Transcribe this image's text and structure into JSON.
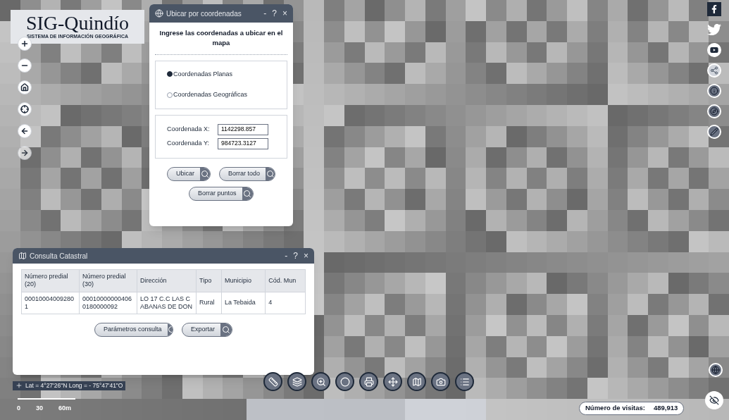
{
  "logo": {
    "title": "SIG-Quindío",
    "subtitle": "SISTEMA DE INFORMACIÓN GEOGRÁFICA"
  },
  "coord_dialog": {
    "title": "Ubicar por coordenadas",
    "window_controls": [
      "-",
      "?",
      "×"
    ],
    "heading": "Ingrese las coordenadas a ubicar en el mapa",
    "options": [
      {
        "label": "Coordenadas Planas",
        "selected": true
      },
      {
        "label": "Coordenadas Geográficas",
        "selected": false
      }
    ],
    "fields": [
      {
        "label": "Coordenada X:",
        "value": "1142298.857"
      },
      {
        "label": "Coordenada Y:",
        "value": "984723.3127"
      }
    ],
    "buttons": [
      "Ubicar",
      "Borrar todo",
      "Borrar puntos"
    ]
  },
  "consulta": {
    "title": "Consulta Catastral",
    "window_controls": [
      "-",
      "?",
      "×"
    ],
    "columns": [
      "Número predial (20)",
      "Número predial (30)",
      "Dirección",
      "Tipo",
      "Municipio",
      "Cód. Mun"
    ],
    "rows": [
      [
        "000100040092801",
        "000100000004060180000092",
        "LO 17 C.C LAS CABANAS DE DON",
        "Rural",
        "La Tebaida",
        "4"
      ]
    ],
    "buttons": [
      "Parámetros consulta",
      "Exportar"
    ]
  },
  "coordinates": "Lat = 4°27'26\"N Long = - 75°47'41\"O",
  "scale": [
    "0",
    "30",
    "60m"
  ],
  "visits": {
    "label": "Número de visitas:",
    "value": "489,913"
  }
}
